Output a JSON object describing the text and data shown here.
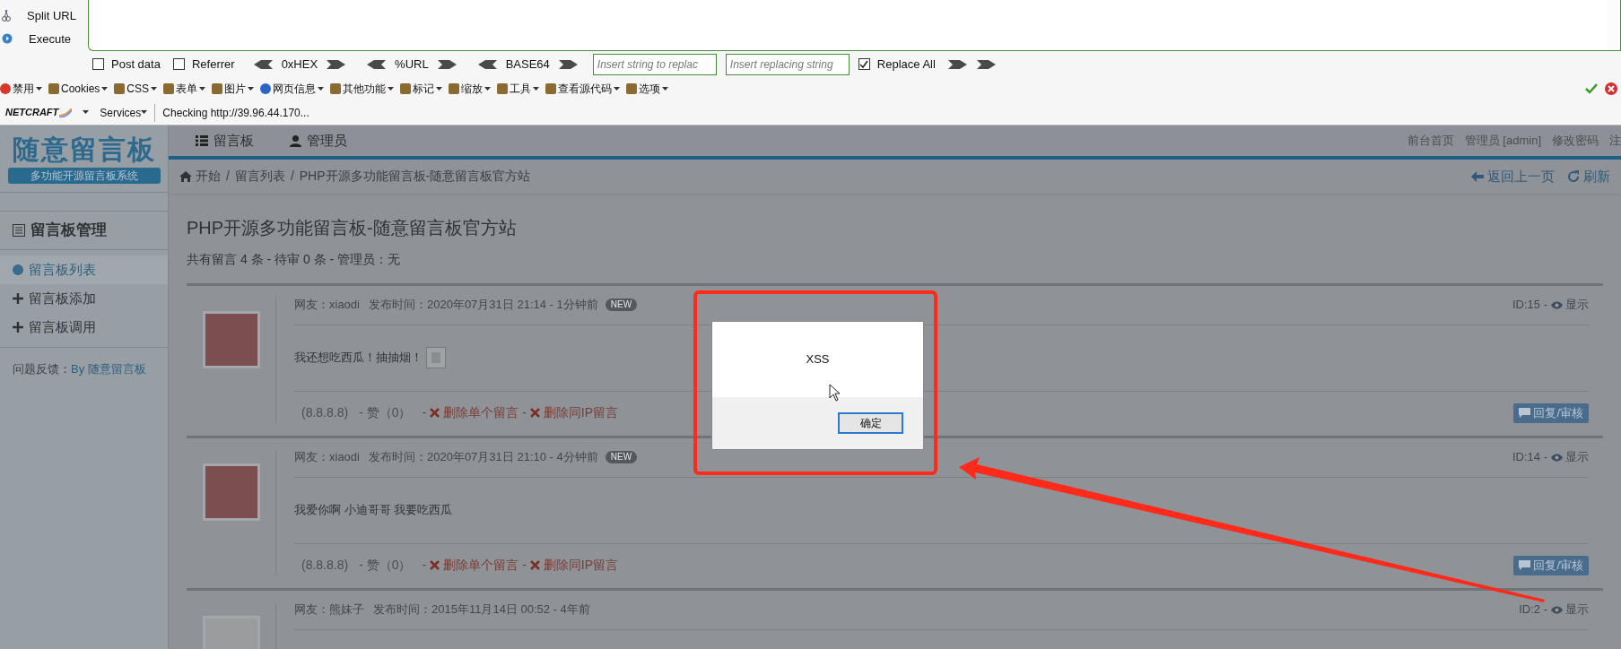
{
  "hackbar": {
    "actions": [
      {
        "label": "Split URL"
      },
      {
        "label": "Execute"
      }
    ],
    "options": [
      {
        "kind": "checkbox",
        "label": "Post data",
        "checked": false
      },
      {
        "kind": "checkbox",
        "label": "Referrer",
        "checked": false
      },
      {
        "kind": "encoder",
        "label": "0xHEX"
      },
      {
        "kind": "encoder",
        "label": "%URL"
      },
      {
        "kind": "encoder",
        "label": "BASE64"
      },
      {
        "kind": "field",
        "placeholder": "Insert string to replac"
      },
      {
        "kind": "field",
        "placeholder": "Insert replacing string"
      },
      {
        "kind": "checkbox",
        "label": "Replace All",
        "checked": true
      }
    ]
  },
  "toolbar": {
    "items": [
      {
        "label": "禁用"
      },
      {
        "label": "Cookies"
      },
      {
        "label": "CSS"
      },
      {
        "label": "表单"
      },
      {
        "label": "图片"
      },
      {
        "label": "网页信息"
      },
      {
        "label": "其他功能"
      },
      {
        "label": "标记"
      },
      {
        "label": "缩放"
      },
      {
        "label": "工具"
      },
      {
        "label": "查看源代码"
      },
      {
        "label": "选项"
      }
    ]
  },
  "netcraft": {
    "logo": "NETCRAFT",
    "services": "Services",
    "status": "Checking http://39.96.44.170..."
  },
  "site": {
    "logo": {
      "title": "随意留言板",
      "subtitle": "多功能开源留言板系统"
    },
    "nav": [
      {
        "label": "留言板"
      },
      {
        "label": "管理员"
      }
    ],
    "top_links": [
      "前台首页",
      "管理员 [admin]",
      "修改密码",
      "注"
    ],
    "breadcrumb": [
      "开始",
      "留言列表",
      "PHP开源多功能留言板-随意留言板官方站"
    ],
    "breadcrumb_separator": "/",
    "back": "返回上一页",
    "refresh": "刷新"
  },
  "sidebar": {
    "heading": "留言板管理",
    "items": [
      {
        "label": "留言板列表",
        "selected": true
      },
      {
        "label": "留言板添加",
        "selected": false
      },
      {
        "label": "留言板调用",
        "selected": false
      }
    ],
    "feedback_label": "问题反馈：",
    "feedback_link": "By 随意留言板"
  },
  "main": {
    "title": "PHP开源多功能留言板-随意留言板官方站",
    "stats": "共有留言 4 条 - 待审 0 条 - 管理员：无",
    "posts": [
      {
        "author": "网友：xiaodi",
        "time": "发布时间：2020年07月31日 21:14 - 1分钟前",
        "badge": "NEW",
        "id": "ID:15 -",
        "visibility": "显示",
        "message": "我还想吃西瓜！抽抽烟！",
        "broken_image": true,
        "ip": "(8.8.8.8)",
        "likes": "- 赞（0）",
        "dash": "-",
        "delete_one": "删除单个留言",
        "delete_ip": "删除同IP留言",
        "reply": "回复/审核"
      },
      {
        "author": "网友：xiaodi",
        "time": "发布时间：2020年07月31日 21:10 - 4分钟前",
        "badge": "NEW",
        "id": "ID:14 -",
        "visibility": "显示",
        "message": "我爱你啊 小迪哥哥 我要吃西瓜",
        "broken_image": false,
        "ip": "(8.8.8.8)",
        "likes": "- 赞（0）",
        "dash": "-",
        "delete_one": "删除单个留言",
        "delete_ip": "删除同IP留言",
        "reply": "回复/审核"
      },
      {
        "author": "网友：熊妹子",
        "time": "发布时间：2015年11月14日 00:52 - 4年前",
        "id": "ID:2 -",
        "visibility": "显示"
      }
    ]
  },
  "dialog": {
    "message": "XSS",
    "button": "确定"
  }
}
